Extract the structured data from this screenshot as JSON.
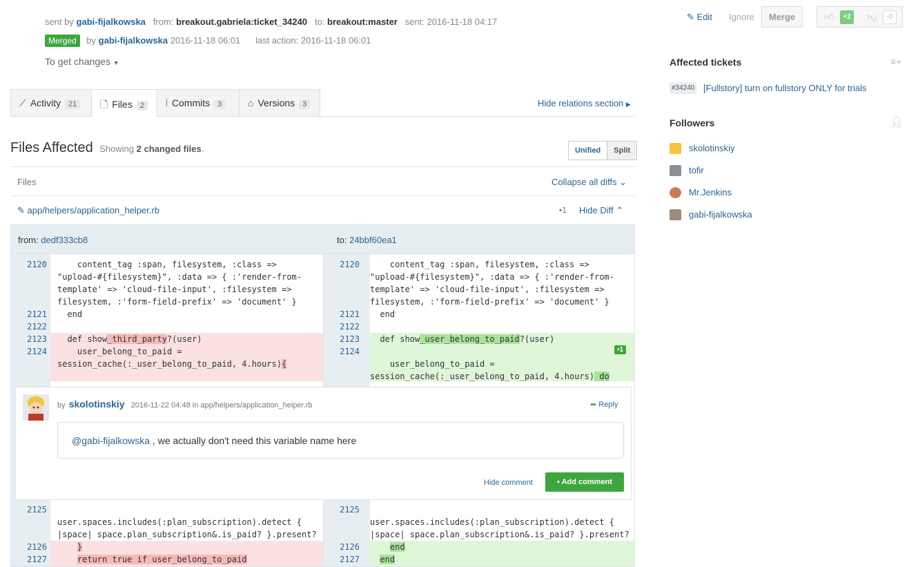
{
  "header": {
    "sent_by_label": "sent by",
    "sent_by": "gabi-fijalkowska",
    "from_label": "from:",
    "from": "breakout.gabriela:ticket_34240",
    "to_label": "to:",
    "to": "breakout:master",
    "sent_label": "sent:",
    "sent": "2016-11-18 04:17",
    "status": "Merged",
    "by_label": "by",
    "merged_by": "gabi-fijalkowska",
    "merged_at": "2016-11-18 06:01",
    "last_action_label": "last action:",
    "last_action": "2016-11-18 06:01",
    "get_changes": "To get changes"
  },
  "actions": {
    "edit": "Edit",
    "ignore": "Ignore",
    "merge": "Merge",
    "votes_up": "+2",
    "votes_down": "-0"
  },
  "tabs": [
    {
      "label": "Activity",
      "count": "21"
    },
    {
      "label": "Files",
      "count": "2"
    },
    {
      "label": "Commits",
      "count": "3"
    },
    {
      "label": "Versions",
      "count": "3"
    }
  ],
  "hide_relations": "Hide relations section",
  "files_affected": {
    "title": "Files Affected",
    "showing": "Showing",
    "count": "2 changed files",
    "view_unified": "Unified",
    "view_split": "Split",
    "files_label": "Files",
    "collapse_all": "Collapse all diffs"
  },
  "file": {
    "name": "app/helpers/application_helper.rb",
    "comment_count": "1",
    "hide_diff": "Hide Diff"
  },
  "diff": {
    "from_label": "from:",
    "from_rev": "dedf333cb8",
    "to_label": "to:",
    "to_rev": "24bbf60ea1",
    "left": {
      "l2120": "2120",
      "c2120": "    content_tag :span, filesystem, :class =>\n\"upload-#{filesystem}\", :data => { :'render-from-\ntemplate' => 'cloud-file-input', :filesystem =>\nfilesystem, :'form-field-prefix' => 'document' }",
      "l2121": "2121",
      "c2121": "  end",
      "l2122": "2122",
      "l2123": "2123",
      "c2123_a": "  def show",
      "c2123_b": "_third_party",
      "c2123_c": "?(user)",
      "l2124": "2124",
      "c2124_a": "    user_belong_to_paid =\nsession_cache(:_user_belong_to_paid, 4.hours)",
      "c2124_b": "{",
      "l2125": "2125",
      "c2125": "\nuser.spaces.includes(:plan_subscription).detect {\n|space| space.plan_subscription&.is_paid? }.present?",
      "l2126": "2126",
      "c2126_a": "    ",
      "c2126_b": "}",
      "l2127": "2127",
      "c2127_a": "    ",
      "c2127_b": "return true if user_belong_to_paid"
    },
    "right": {
      "l2120": "2120",
      "c2120": "    content_tag :span, filesystem, :class =>\n\"upload-#{filesystem}\", :data => { :'render-from-\ntemplate' => 'cloud-file-input', :filesystem =>\nfilesystem, :'form-field-prefix' => 'document' }",
      "l2121": "2121",
      "c2121": "  end",
      "l2122": "2122",
      "l2123": "2123",
      "c2123_a": "  def show",
      "c2123_b": "_user_belong_to_paid",
      "c2123_c": "?(user)",
      "l2124": "2124",
      "comment_badge": "1",
      "c2124_a": "    user_belong_to_paid =\nsession_cache(:_user_belong_to_paid, 4.hours)",
      "c2124_b": " do",
      "l2125": "2125",
      "c2125": "\nuser.spaces.includes(:plan_subscription).detect {\n|space| space.plan_subscription&.is_paid? }.present?",
      "l2126": "2126",
      "c2126_a": "    ",
      "c2126_b": "end",
      "l2127": "2127",
      "c2127_a": "  ",
      "c2127_b": "end"
    }
  },
  "comment": {
    "by_label": "by",
    "author": "skolotinskiy",
    "meta": "2016-11-22 04:48 in app/helpers/application_helper.rb",
    "reply": "Reply",
    "mention": "@gabi-fijalkowska",
    "text": " , we actually don't need this variable name here",
    "hide": "Hide comment",
    "add": "Add comment"
  },
  "sidebar": {
    "tickets_title": "Affected tickets",
    "ticket_id": "#34240",
    "ticket_title": "[Fullstory] turn on fullstory ONLY for trials",
    "followers_title": "Followers",
    "followers": [
      "skolotinskiy",
      "tofir",
      "Mr.Jenkins",
      "gabi-fijalkowska"
    ]
  },
  "colors": {
    "link": "#2a6496",
    "merged": "#3fa63f",
    "deleted_bg": "#fbe1e1",
    "added_bg": "#dff6d9"
  }
}
